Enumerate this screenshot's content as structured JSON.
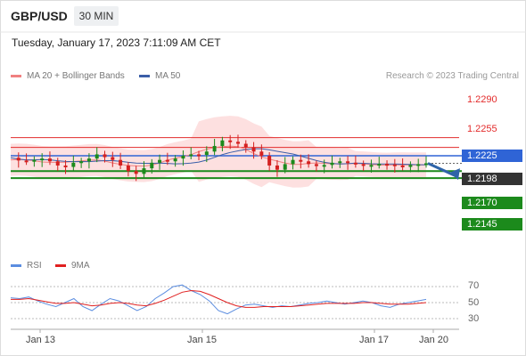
{
  "header": {
    "symbol": "GBP/USD",
    "timeframe": "30 MIN",
    "datetime": "Tuesday, January 17, 2023 7:11:09 AM CET"
  },
  "legend": {
    "ma20_label": "MA 20 + Bollinger Bands",
    "ma50_label": "MA 50",
    "credit": "Research © 2023 Trading Central"
  },
  "rsi_legend": {
    "rsi_label": "RSI",
    "ma_label": "9MA"
  },
  "colors": {
    "resistance": "#e32b2b",
    "pivot_blue": "#2f64d6",
    "support": "#1c8a1c",
    "current": "#333333",
    "bollinger_fill": "#fde0e0",
    "ma20": "#f08080",
    "ma50": "#3b5ea8",
    "candle_up": "#1c8a1c",
    "candle_down": "#d42020",
    "arrow": "#2f64a8"
  },
  "levels": {
    "r2": "1.2290",
    "r1": "1.2255",
    "pivot": "1.2225",
    "current": "1.2198",
    "s1": "1.2170",
    "s2": "1.2145"
  },
  "rsi_ticks": [
    "70",
    "50",
    "30"
  ],
  "x_labels": [
    "Jan 13",
    "Jan 15",
    "Jan 17",
    "Jan 20"
  ],
  "chart_data": {
    "type": "candlestick",
    "title": "GBP/USD",
    "timeframe": "30 MIN",
    "x_labels": [
      "Jan 13",
      "Jan 15",
      "Jan 17",
      "Jan 20"
    ],
    "price_levels": {
      "resistance": [
        1.229,
        1.2255
      ],
      "pivot": 1.2225,
      "current": 1.2198,
      "support": [
        1.217,
        1.2145
      ]
    },
    "close_path": [
      1.2218,
      1.2208,
      1.2205,
      1.221,
      1.2215,
      1.2205,
      1.219,
      1.2185,
      1.22,
      1.2205,
      1.2215,
      1.223,
      1.222,
      1.221,
      1.219,
      1.217,
      1.216,
      1.218,
      1.22,
      1.221,
      1.2205,
      1.2215,
      1.2225,
      1.223,
      1.2228,
      1.224,
      1.226,
      1.228,
      1.2275,
      1.2268,
      1.2255,
      1.224,
      1.2225,
      1.219,
      1.2175,
      1.2195,
      1.221,
      1.2205,
      1.2195,
      1.2188,
      1.2192,
      1.22,
      1.2205,
      1.22,
      1.2195,
      1.219,
      1.2192,
      1.2196,
      1.2194,
      1.219,
      1.2185,
      1.2192,
      1.2195,
      1.2198
    ],
    "rsi_ticks": [
      70,
      50,
      30
    ],
    "rsi_approx": [
      56,
      55,
      57,
      52,
      48,
      45,
      50,
      55,
      45,
      40,
      48,
      55,
      52,
      46,
      40,
      45,
      55,
      62,
      70,
      72,
      65,
      60,
      52,
      40,
      36,
      42,
      47,
      48,
      46,
      44,
      46,
      45,
      47,
      49,
      50,
      52,
      50,
      48,
      50,
      52,
      50,
      46,
      44,
      48,
      50,
      52,
      54
    ],
    "rsi_ma_approx": [
      54,
      54,
      55,
      53,
      51,
      49,
      49,
      50,
      48,
      46,
      47,
      49,
      50,
      49,
      47,
      46,
      49,
      53,
      58,
      63,
      65,
      64,
      60,
      55,
      50,
      46,
      44,
      44,
      45,
      45,
      45,
      45,
      46,
      47,
      48,
      49,
      49,
      49,
      49,
      50,
      50,
      49,
      48,
      48,
      48,
      49,
      50
    ]
  }
}
